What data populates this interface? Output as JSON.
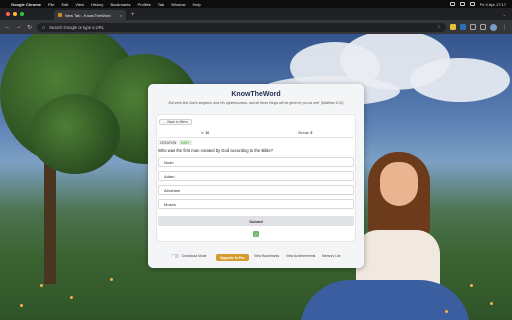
{
  "menubar": {
    "app": "Google Chrome",
    "items": [
      "File",
      "Edit",
      "View",
      "History",
      "Bookmarks",
      "Profiles",
      "Tab",
      "Window",
      "Help"
    ],
    "datetime": "Fri 4 Apr 17:17"
  },
  "tab": {
    "title": "New Tab - KnowTheWord",
    "close": "×",
    "new": "+"
  },
  "toolbar": {
    "url_placeholder": "Search Google or type a URL"
  },
  "card": {
    "title": "KnowTheWord",
    "verse": "But seek first God's kingdom, and His righteousness; and all these things will be given to you as well. (Matthew 6:33)",
    "back_label": "← Back to Menu",
    "verse_label": "V:",
    "verse_value": "10",
    "streak_label": "Streak:",
    "streak_value": "5",
    "tag_category": "CREATION",
    "tag_level": "EASY",
    "question": "Who was the first man created by God according to the Bible?",
    "options": [
      "Noah",
      "Adam",
      "Abraham",
      "Moses"
    ],
    "submit_label": "Submit",
    "footer": {
      "download_mode": "Download Mode",
      "upgrade": "Upgrade to Pro",
      "view_bookmarks": "View Bookmarks",
      "view_achievements": "View Achievements",
      "memory_list": "Memory List"
    }
  },
  "colors": {
    "accent": "#d79a2c",
    "title": "#1f2d52",
    "easy": "#6dbb6d"
  }
}
